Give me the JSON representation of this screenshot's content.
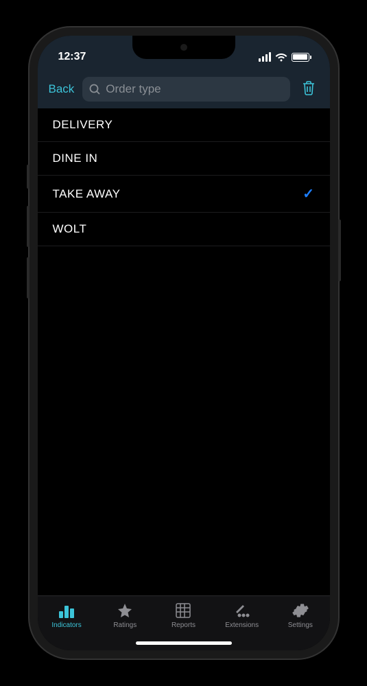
{
  "status_bar": {
    "time": "12:37"
  },
  "nav_bar": {
    "back_label": "Back",
    "search_placeholder": "Order type"
  },
  "list": {
    "items": [
      {
        "label": "DELIVERY",
        "selected": false
      },
      {
        "label": "DINE IN",
        "selected": false
      },
      {
        "label": "TAKE AWAY",
        "selected": true
      },
      {
        "label": "WOLT",
        "selected": false
      }
    ]
  },
  "tab_bar": {
    "items": [
      {
        "label": "Indicators",
        "active": true
      },
      {
        "label": "Ratings",
        "active": false
      },
      {
        "label": "Reports",
        "active": false
      },
      {
        "label": "Extensions",
        "active": false
      },
      {
        "label": "Settings",
        "active": false
      }
    ]
  }
}
